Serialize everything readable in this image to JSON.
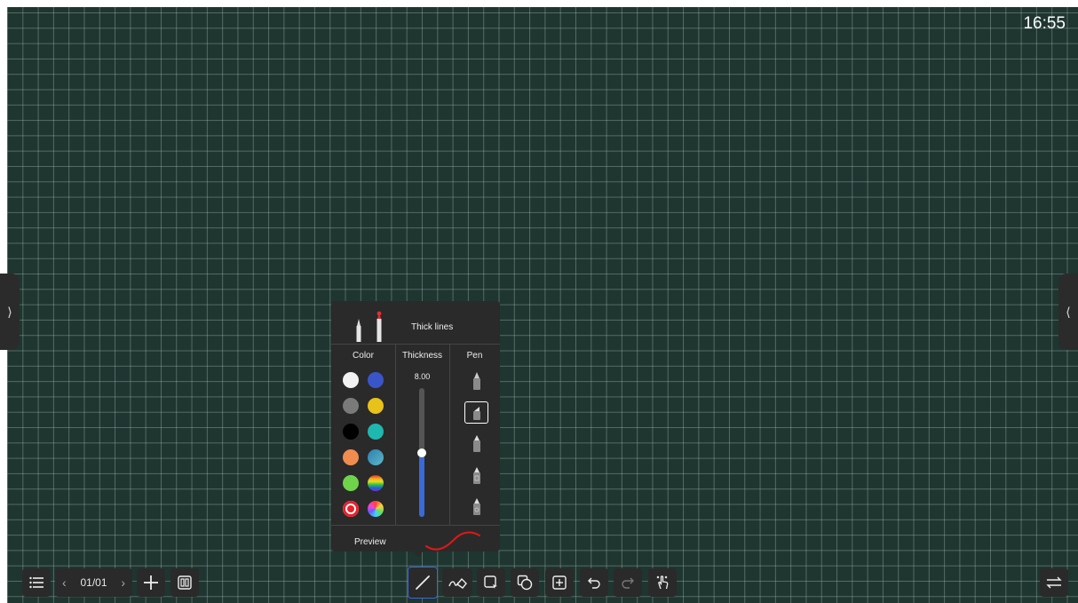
{
  "status": {
    "clock": "16:55"
  },
  "pages": {
    "indicator": "01/01"
  },
  "pen_panel": {
    "header_label": "Thick lines",
    "color_title": "Color",
    "thickness_title": "Thickness",
    "pen_title": "Pen",
    "thickness_value": "8.00",
    "thickness_fraction": 0.5,
    "preview_label": "Preview",
    "colors_left": [
      "#f2f2f2",
      "#7a7a7a",
      "#000000",
      "#f08c50",
      "#6fd44a",
      "#e8212a"
    ],
    "colors_right": [
      "#3a55c9",
      "#e6c21a",
      "#1fb8b0",
      "#4aa0c8",
      "rainbow",
      "color-wheel"
    ],
    "selected_color": "#e8212a"
  },
  "toolbar": {
    "left": [
      "menu-icon",
      "prev-page-icon",
      "next-page-icon",
      "add-page-icon",
      "page-overview-icon"
    ],
    "center": [
      "pen-icon",
      "eraser-icon",
      "lasso-select-icon",
      "shapes-icon",
      "insert-icon",
      "undo-icon",
      "redo-icon",
      "gesture-icon"
    ],
    "right": [
      "swap-toolbar-icon"
    ]
  },
  "colors": {
    "board": "#1f3530",
    "grid": "#8fa89e",
    "button": "#2a2a2a",
    "accent": "#3a6ad6"
  }
}
